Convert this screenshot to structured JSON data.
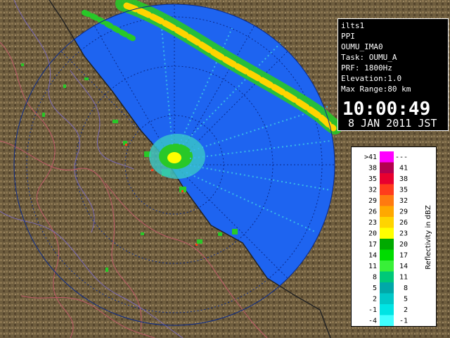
{
  "info_panel": {
    "lines": [
      "ilts1",
      "PPI",
      "OUMU_IMA0",
      "Task: OUMU_A",
      "PRF: 1800Hz",
      "Elevation:1.0",
      "Max Range:80 km"
    ],
    "time": "10:00:49",
    "date": "8 JAN 2011 JST"
  },
  "legend": {
    "title": "Reflectivity in dBZ",
    "entries": [
      {
        "left": ">41",
        "right": "---",
        "color": "#ff00ff"
      },
      {
        "left": "38",
        "right": "41",
        "color": "#b4004f"
      },
      {
        "left": "35",
        "right": "38",
        "color": "#e8002f"
      },
      {
        "left": "32",
        "right": "35",
        "color": "#ff3c1c"
      },
      {
        "left": "29",
        "right": "32",
        "color": "#ff7a10"
      },
      {
        "left": "26",
        "right": "29",
        "color": "#ffa800"
      },
      {
        "left": "23",
        "right": "26",
        "color": "#ffd400"
      },
      {
        "left": "20",
        "right": "23",
        "color": "#ffff00"
      },
      {
        "left": "17",
        "right": "20",
        "color": "#00aa00"
      },
      {
        "left": "14",
        "right": "17",
        "color": "#00dc00"
      },
      {
        "left": "11",
        "right": "14",
        "color": "#38f038"
      },
      {
        "left": "8",
        "right": "11",
        "color": "#00c878"
      },
      {
        "left": "5",
        "right": "8",
        "color": "#00a8a8"
      },
      {
        "left": "2",
        "right": "5",
        "color": "#00c8c8"
      },
      {
        "left": "-1",
        "right": "2",
        "color": "#00e4e4"
      },
      {
        "left": "-4",
        "right": "-1",
        "color": "#40ffff"
      }
    ]
  },
  "colors": {
    "land": "#6b5a3c",
    "sea": "#1e64f0",
    "sea_outer": "#1a50e0",
    "rain_band": "#ffd400"
  }
}
